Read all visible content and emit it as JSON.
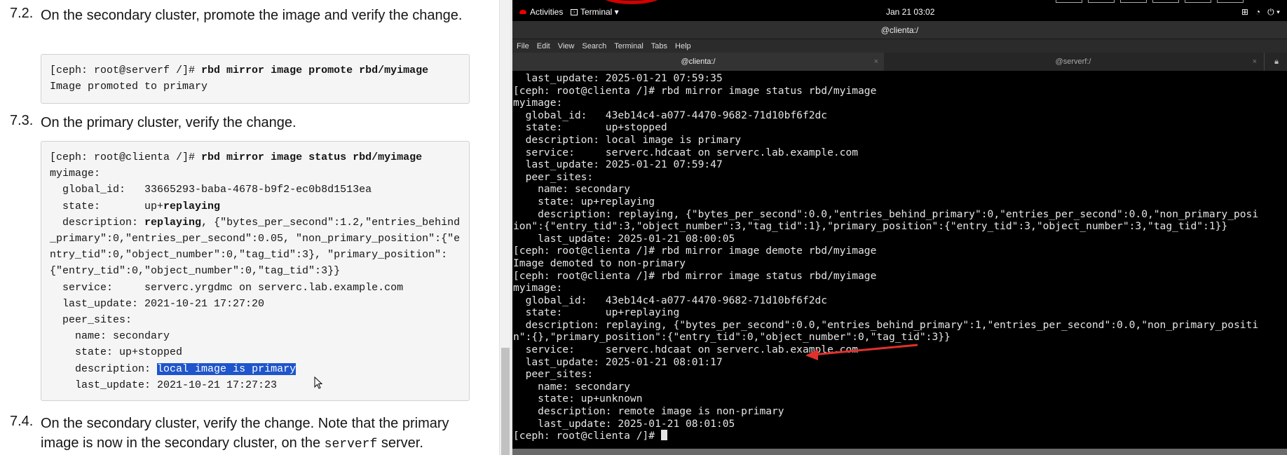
{
  "doc": {
    "steps": [
      {
        "num": "7.2.",
        "text": "On the secondary cluster, promote the image and verify the change."
      },
      {
        "num": "7.3.",
        "text": "On the primary cluster, verify the change."
      },
      {
        "num": "7.4.",
        "text_pre": "On the secondary cluster, verify the change. Note that the primary image is now in the secondary cluster, on the ",
        "text_code": "serverf",
        "text_post": " server."
      }
    ],
    "code1": {
      "prompt": "[ceph: root@serverf /]# ",
      "cmd": "rbd mirror image promote rbd/myimage",
      "output": "Image promoted to primary"
    },
    "code2": {
      "prompt": "[ceph: root@clienta /]# ",
      "cmd": "rbd mirror image status rbd/myimage",
      "l1": "myimage:",
      "l2": "  global_id:   33665293-baba-4678-b9f2-ec0b8d1513ea",
      "l3_pre": "  state:       up+",
      "l3_bold": "replaying",
      "l4_pre": "  description: ",
      "l4_bold": "replaying",
      "l4_rest": ", {\"bytes_per_second\":1.2,\"entries_behind_primary\":0,\"entries_per_second\":0.05, \"non_primary_position\":{\"entry_tid\":0,\"object_number\":0,\"tag_tid\":3}, \"primary_position\":{\"entry_tid\":0,\"object_number\":0,\"tag_tid\":3}}",
      "l5": "  service:     serverc.yrgdmc on serverc.lab.example.com",
      "l6": "  last_update: 2021-10-21 17:27:20",
      "l7": "  peer_sites:",
      "l8": "    name: secondary",
      "l9": "    state: up+stopped",
      "l10_pre": "    description: ",
      "l10_sel": "local image is primary",
      "l11": "    last_update: 2021-10-21 17:27:23"
    }
  },
  "topbar": {
    "activities": "Activities",
    "app": "Terminal ▾",
    "clock": "Jan 21  03:02",
    "tray": [
      "⊞",
      "◔",
      "⏻ ▾"
    ]
  },
  "window": {
    "title": "@clienta:/"
  },
  "menu": [
    "File",
    "Edit",
    "View",
    "Search",
    "Terminal",
    "Tabs",
    "Help"
  ],
  "tabs": [
    {
      "label": "@clienta:/",
      "close": "×"
    },
    {
      "label": "@serverf:/",
      "close": "×"
    }
  ],
  "terminal": {
    "lines": [
      "  last_update: 2025-01-21 07:59:35",
      "[ceph: root@clienta /]# rbd mirror image status rbd/myimage",
      "myimage:",
      "  global_id:   43eb14c4-a077-4470-9682-71d10bf6f2dc",
      "  state:       up+stopped",
      "  description: local image is primary",
      "  service:     serverc.hdcaat on serverc.lab.example.com",
      "  last_update: 2025-01-21 07:59:47",
      "  peer_sites:",
      "    name: secondary",
      "    state: up+replaying",
      "    description: replaying, {\"bytes_per_second\":0.0,\"entries_behind_primary\":0,\"entries_per_second\":0.0,\"non_primary_posi",
      "ion\":{\"entry_tid\":3,\"object_number\":3,\"tag_tid\":1},\"primary_position\":{\"entry_tid\":3,\"object_number\":3,\"tag_tid\":1}}",
      "    last_update: 2025-01-21 08:00:05",
      "[ceph: root@clienta /]# rbd mirror image demote rbd/myimage",
      "Image demoted to non-primary",
      "[ceph: root@clienta /]# rbd mirror image status rbd/myimage",
      "myimage:",
      "  global_id:   43eb14c4-a077-4470-9682-71d10bf6f2dc",
      "  state:       up+replaying",
      "  description: replaying, {\"bytes_per_second\":0.0,\"entries_behind_primary\":1,\"entries_per_second\":0.0,\"non_primary_positi",
      "n\":{},\"primary_position\":{\"entry_tid\":0,\"object_number\":0,\"tag_tid\":3}}",
      "  service:     serverc.hdcaat on serverc.lab.example.com",
      "  last_update: 2025-01-21 08:01:17",
      "  peer_sites:",
      "    name: secondary",
      "    state: up+unknown",
      "    description: remote image is non-primary",
      "    last_update: 2025-01-21 08:01:05"
    ],
    "prompt": "[ceph: root@clienta /]# "
  },
  "colors": {
    "arrow": "#e0312b",
    "selection": "#1f55cc"
  }
}
